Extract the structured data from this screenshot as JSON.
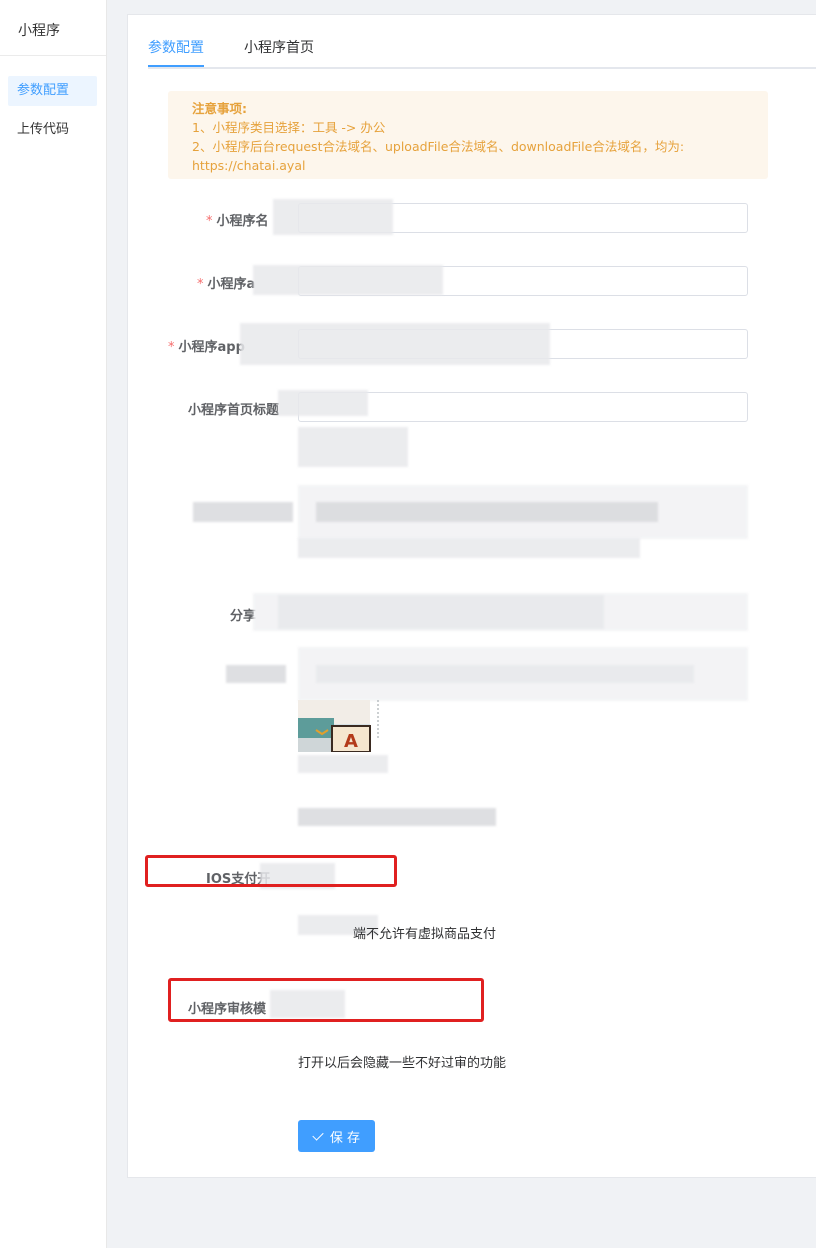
{
  "sidebar": {
    "title": "小程序",
    "items": [
      {
        "label": "参数配置",
        "active": true
      },
      {
        "label": "上传代码",
        "active": false
      }
    ]
  },
  "tabs": [
    {
      "label": "参数配置",
      "active": true
    },
    {
      "label": "小程序首页",
      "active": false
    }
  ],
  "notice": {
    "title": "注意事项:",
    "line1": "1、小程序类目选择：工具 -> 办公",
    "line2": "2、小程序后台request合法域名、uploadFile合法域名、downloadFile合法域名，均为:",
    "line3": "https://chatai.ayal"
  },
  "form": {
    "name_label": "小程序名",
    "appid_label": "小程序a",
    "appsecret_label": "小程序app",
    "home_title_label": "小程序首页标题",
    "share_label": "分享",
    "ios_pay_label": "IOS支付开",
    "ios_pay_hint": "端不允许有虚拟商品支付",
    "review_mode_label": "小程序审核模",
    "review_mode_hint": "打开以后会隐藏一些不好过审的功能"
  },
  "actions": {
    "save_label": "保 存"
  },
  "colors": {
    "accent": "#409eff",
    "notice_bg": "#fdf6ec",
    "notice_text": "#e6a23c",
    "highlight": "#e02020"
  }
}
